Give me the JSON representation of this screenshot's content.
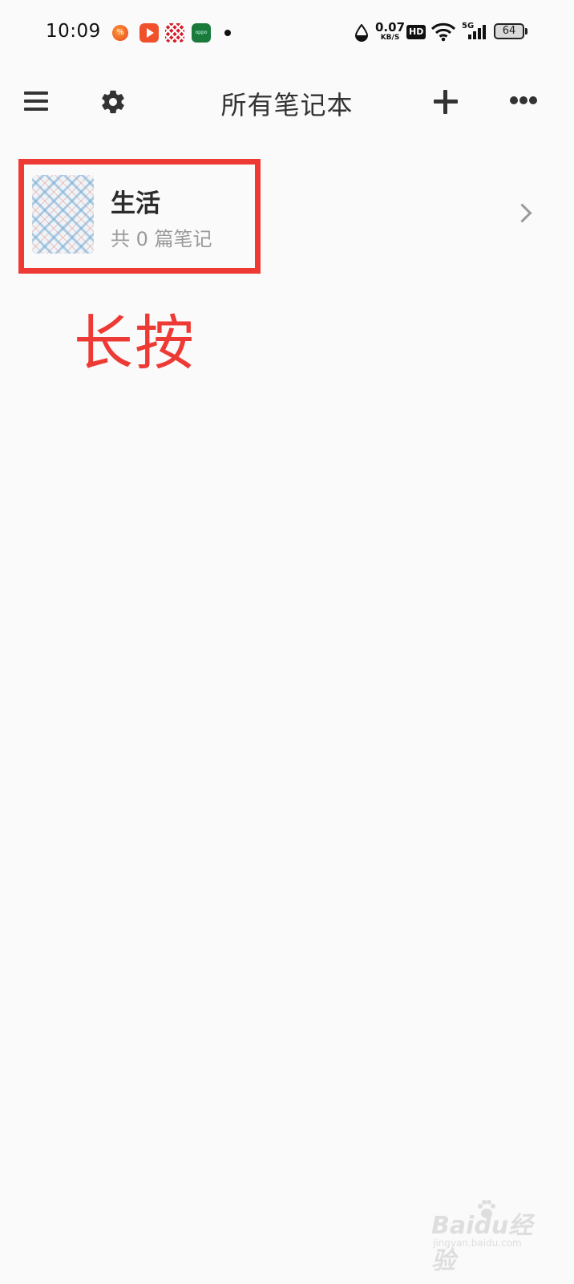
{
  "status_bar": {
    "time": "10:09",
    "net_speed_value": "0.07",
    "net_speed_unit": "KB/S",
    "hd_label": "HD",
    "network_type": "5G",
    "battery": "64"
  },
  "toolbar": {
    "title": "所有笔记本"
  },
  "notebooks": [
    {
      "name": "生活",
      "count_text": "共 0 篇笔记"
    }
  ],
  "annotation": {
    "text": "长按",
    "color": "#ee3a34"
  },
  "watermark": {
    "text": "Baidu经验",
    "url": "jingyan.baidu.com"
  },
  "colors": {
    "background": "#fafafa",
    "text_primary": "#333333",
    "text_secondary": "#9a9a9a"
  }
}
